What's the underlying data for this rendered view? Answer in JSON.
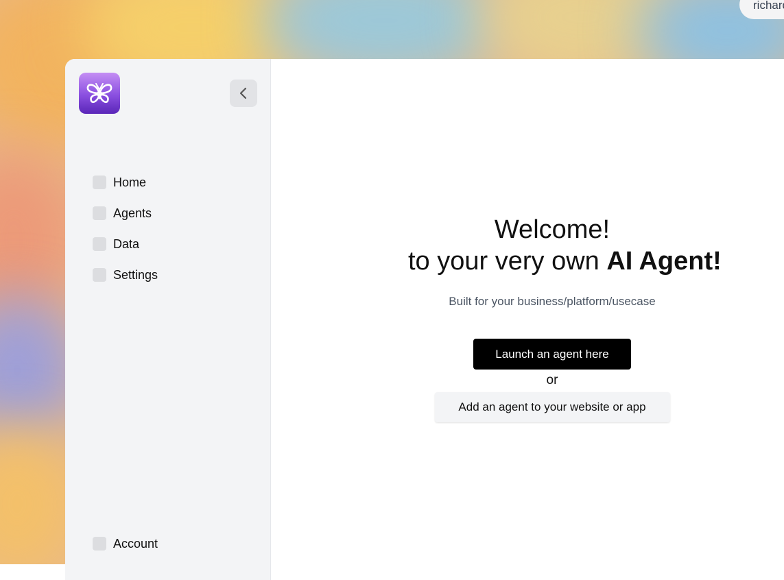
{
  "user": {
    "name": "richard"
  },
  "sidebar": {
    "logo_icon": "butterfly-icon",
    "collapse_icon": "chevron-left-icon",
    "items": [
      {
        "label": "Home"
      },
      {
        "label": "Agents"
      },
      {
        "label": "Data"
      },
      {
        "label": "Settings"
      }
    ],
    "account_label": "Account"
  },
  "main": {
    "title_line1": "Welcome!",
    "title_line2_prefix": "to your very own ",
    "title_line2_bold": "AI Agent!",
    "subtitle": "Built for your business/platform/usecase",
    "launch_button": "Launch an agent here",
    "or_text": "or",
    "add_button": "Add an agent to your website or app"
  },
  "colors": {
    "sidebar_bg": "#f3f4f6",
    "primary_button": "#000000",
    "secondary_button": "#f3f4f6",
    "logo_gradient": [
      "#c48ef4",
      "#5a26b8"
    ]
  }
}
